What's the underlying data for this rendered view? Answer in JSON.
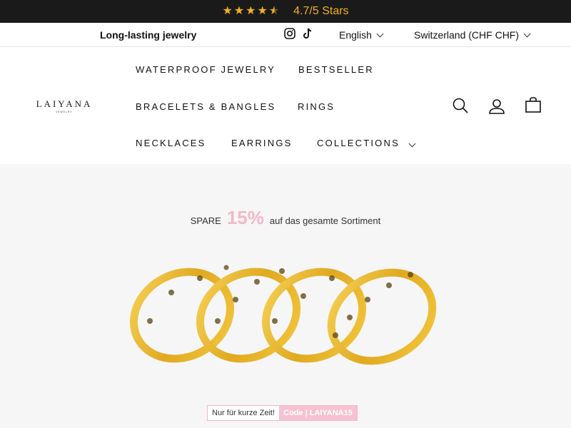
{
  "announcement": {
    "rating_text": "4.7/5 Stars",
    "star_color": "#f2b01e"
  },
  "utility": {
    "tagline": "Long-lasting jewelry",
    "social": [
      "instagram-icon",
      "tiktok-icon"
    ],
    "language": "English",
    "country": "Switzerland (CHF CHF)"
  },
  "brand": {
    "name": "LAIYANA",
    "sub": "JEWELRY"
  },
  "nav": {
    "waterproof": "WATERPROOF JEWELRY",
    "bestseller": "BESTSELLER",
    "bracelets": "BRACELETS & BANGLES",
    "rings": "RINGS",
    "necklaces": "NECKLACES",
    "earrings": "EARRINGS",
    "collections": "COLLECTIONS"
  },
  "header_icons": [
    "search-icon",
    "account-icon",
    "cart-icon"
  ],
  "hero": {
    "promo_prefix": "SPARE",
    "promo_percent": "15%",
    "promo_suffix": "auf das gesamte Sortiment",
    "code_left": "Nur für kurze Zeit!",
    "code_right": "Code | LAIYANA15",
    "accent_pink": "#f4b7c8",
    "gold": "#e5b52a"
  }
}
